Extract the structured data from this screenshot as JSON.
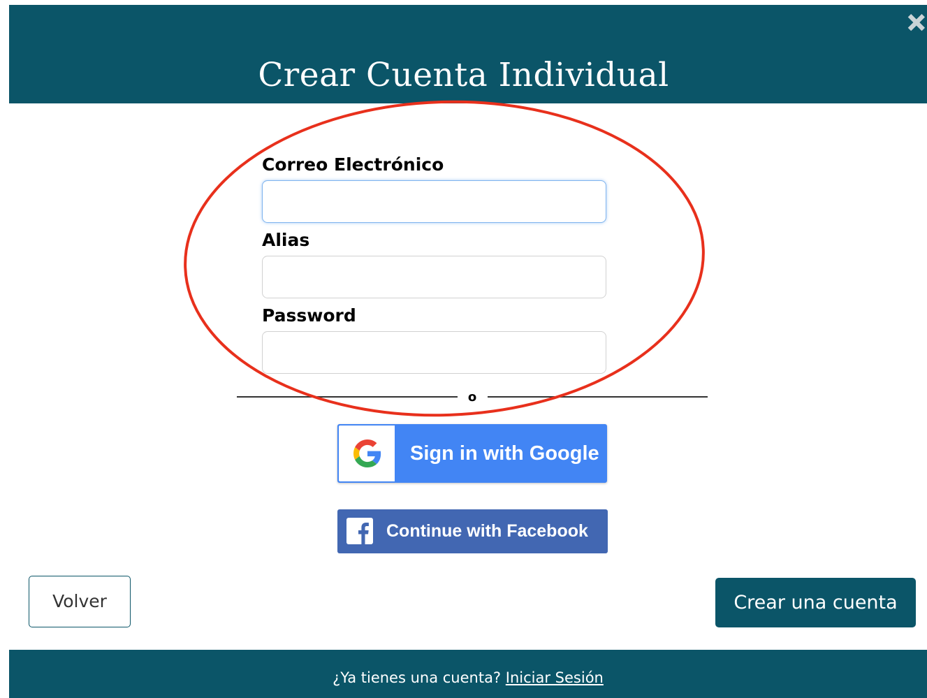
{
  "header": {
    "title": "Crear Cuenta Individual"
  },
  "form": {
    "email_label": "Correo Electrónico",
    "email_value": "",
    "alias_label": "Alias",
    "alias_value": "",
    "password_label": "Password",
    "password_value": "",
    "divider_text": "o"
  },
  "social": {
    "google_label": "Sign in with Google",
    "facebook_label": "Continue with Facebook"
  },
  "actions": {
    "back_label": "Volver",
    "create_label": "Crear una cuenta"
  },
  "footer": {
    "prompt": "¿Ya tienes una cuenta?",
    "login_link": "Iniciar Sesión"
  },
  "icons": {
    "close": "close-icon",
    "google": "google-logo-icon",
    "facebook": "facebook-logo-icon"
  },
  "colors": {
    "brand": "#0b5568",
    "google_blue": "#4285f4",
    "facebook_blue": "#4267b2",
    "annotation_red": "#e8301c"
  }
}
